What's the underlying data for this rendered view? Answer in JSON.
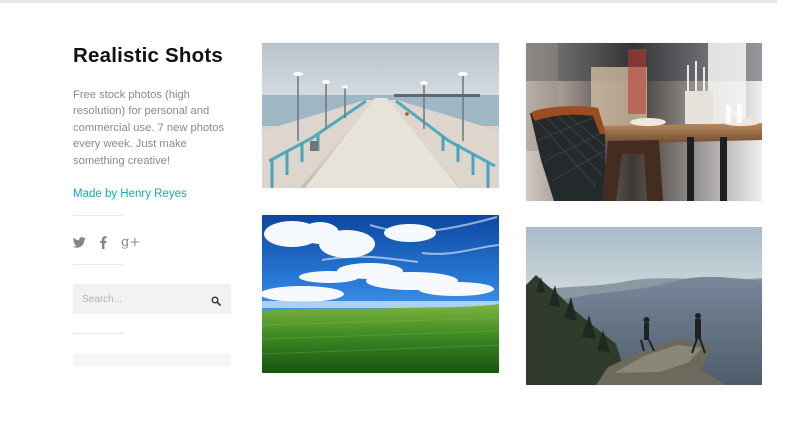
{
  "site": {
    "title": "Realistic Shots",
    "description": "Free stock photos (high resolution) for personal and commercial use. 7 new photos every week. Just make something creative!",
    "author_link": "Made by Henry Reyes"
  },
  "social": [
    {
      "name": "twitter",
      "icon": "twitter-icon"
    },
    {
      "name": "facebook",
      "icon": "facebook-icon"
    },
    {
      "name": "google-plus",
      "icon": "google-plus-icon",
      "glyph": "g+"
    }
  ],
  "search": {
    "placeholder": "Search...",
    "button_icon": "search-icon"
  },
  "colors": {
    "accent": "#17a9b3",
    "title": "#111111",
    "body_text": "#8a8a8a",
    "panel": "#f2f2f2"
  },
  "gallery": [
    {
      "subject": "pier-photo"
    },
    {
      "subject": "cafe-table-photo"
    },
    {
      "subject": "blue-sky-field-photo"
    },
    {
      "subject": "mountain-hikers-photo"
    }
  ]
}
